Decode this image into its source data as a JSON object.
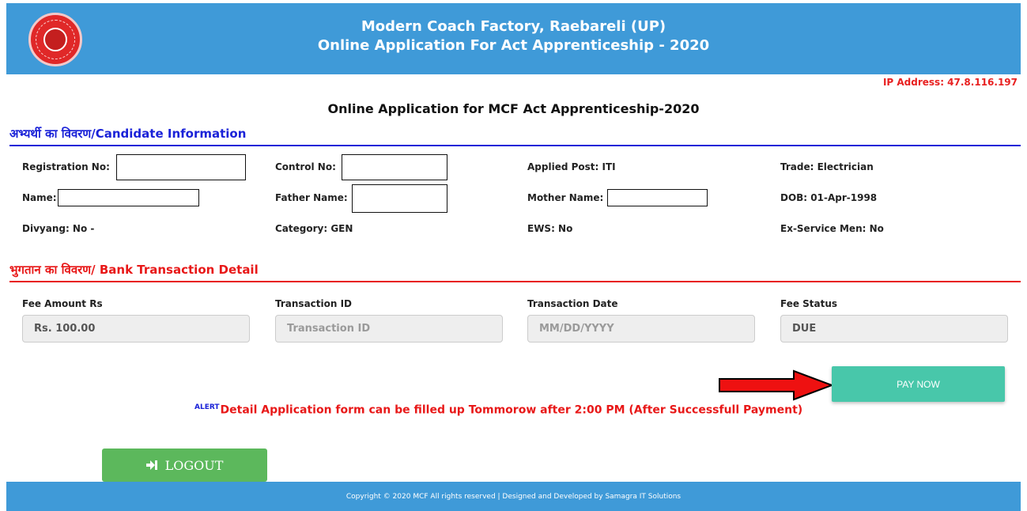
{
  "header": {
    "line1": "Modern Coach Factory, Raebareli (UP)",
    "line2": "Online Application For Act Apprenticeship - 2020",
    "logo_icon": "indian-railways-logo"
  },
  "ip_address": "IP Address: 47.8.116.197",
  "page_title": "Online Application for MCF Act Apprenticeship-2020",
  "candidate_section": {
    "title": "अभ्यर्थी का विवरण/Candidate Information",
    "registration_label": "Registration No:",
    "control_label": "Control No:",
    "applied_post": "Applied Post: ITI",
    "trade": "Trade: Electrician",
    "name_label": "Name:",
    "father_label": "Father Name:",
    "mother_label": "Mother Name:",
    "dob": "DOB: 01-Apr-1998",
    "divyang": "Divyang: No -",
    "category": "Category: GEN",
    "ews": "EWS: No",
    "ex_service": "Ex-Service Men: No"
  },
  "bank_section": {
    "title": "भुगतान का विवरण/ Bank Transaction Detail",
    "fee_amount_label": "Fee Amount Rs",
    "fee_amount_value": "Rs. 100.00",
    "transaction_id_label": "Transaction ID",
    "transaction_id_placeholder": "Transaction ID",
    "transaction_date_label": "Transaction Date",
    "transaction_date_placeholder": "MM/DD/YYYY",
    "fee_status_label": "Fee Status",
    "fee_status_value": "DUE"
  },
  "pay_button": "PAY NOW",
  "alert": {
    "tag": "ALERT",
    "text": "Detail Application form can be filled up Tommorow after 2:00 PM (After Successfull Payment)"
  },
  "logout_button": "LOGOUT",
  "footer": "Copyright © 2020 MCF All rights reserved | Designed and Developed by Samagra IT Solutions",
  "colors": {
    "header_bg": "#3f9ad8",
    "pay_button": "#48c7aa",
    "logout_button": "#5cb85c",
    "alert_red": "#e81818",
    "section_blue": "#1a22d8"
  }
}
